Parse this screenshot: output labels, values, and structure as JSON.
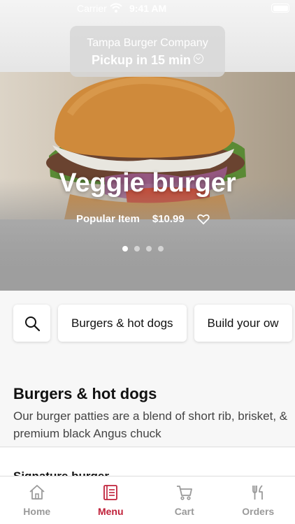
{
  "status_bar": {
    "carrier": "Carrier",
    "time": "9:41 AM"
  },
  "store": {
    "name": "Tampa Burger Company",
    "pickup_text": "Pickup in 15 min"
  },
  "featured": {
    "title": "Veggie burger",
    "tag": "Popular Item",
    "price": "$10.99",
    "carousel": {
      "count": 4,
      "active_index": 0
    }
  },
  "categories": {
    "search_icon": "search-icon",
    "items": [
      "Burgers & hot dogs",
      "Build your ow"
    ]
  },
  "section": {
    "title": "Burgers & hot dogs",
    "description": "Our burger patties are a blend of short rib, brisket, & premium black Angus chuck",
    "first_item": "Signature burger"
  },
  "tab_bar": {
    "tabs": [
      {
        "label": "Home",
        "icon": "home-icon",
        "active": false
      },
      {
        "label": "Menu",
        "icon": "menu-icon",
        "active": true
      },
      {
        "label": "Cart",
        "icon": "cart-icon",
        "active": false
      },
      {
        "label": "Orders",
        "icon": "orders-icon",
        "active": false
      }
    ]
  },
  "colors": {
    "accent": "#c0213a",
    "inactive": "#9a9a9a"
  }
}
